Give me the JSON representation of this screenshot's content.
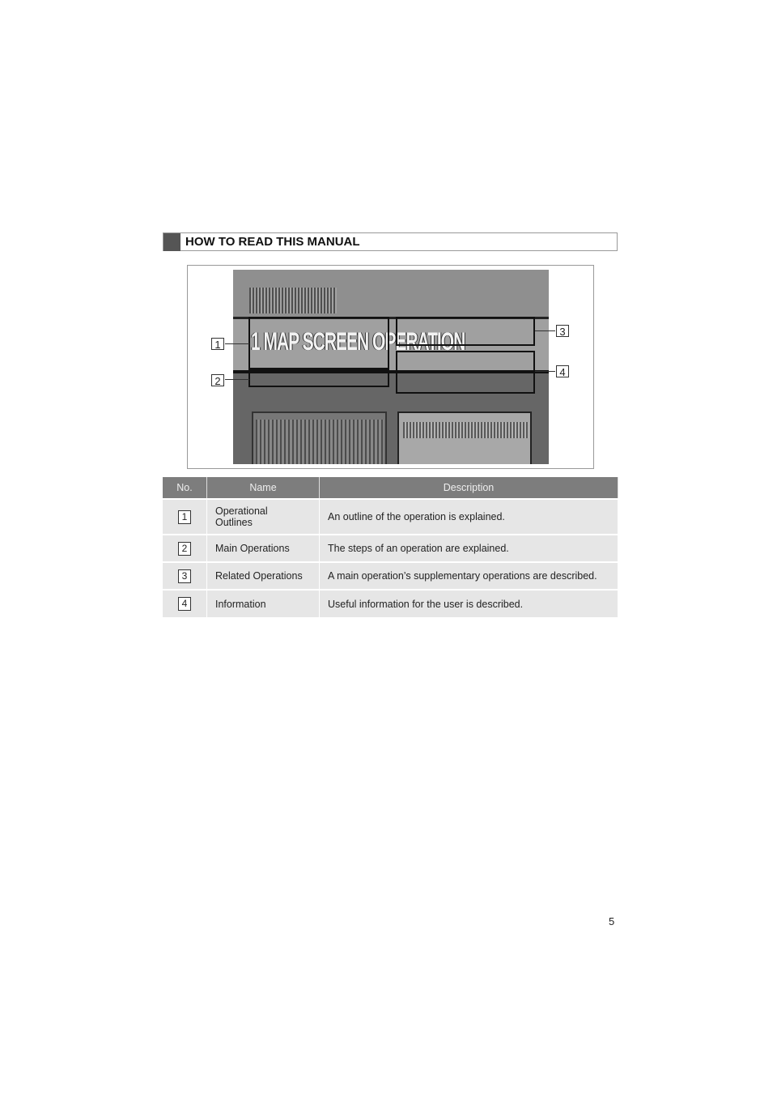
{
  "section": {
    "title": "HOW TO READ THIS MANUAL"
  },
  "illustration": {
    "lettering": "1. MAP SCREEN OPERATION",
    "callouts": [
      "1",
      "2",
      "3",
      "4"
    ]
  },
  "table": {
    "headers": [
      "No.",
      "Name",
      "Description"
    ],
    "rows": [
      {
        "no": "1",
        "name": "Operational Outlines",
        "description": "An outline of the operation is explained."
      },
      {
        "no": "2",
        "name": "Main Operations",
        "description": "The steps of an operation are explained."
      },
      {
        "no": "3",
        "name": "Related Operations",
        "description": "A main operation’s supplementary operations are described."
      },
      {
        "no": "4",
        "name": "Information",
        "description": "Useful information for the user is described."
      }
    ]
  },
  "page_number": "5"
}
